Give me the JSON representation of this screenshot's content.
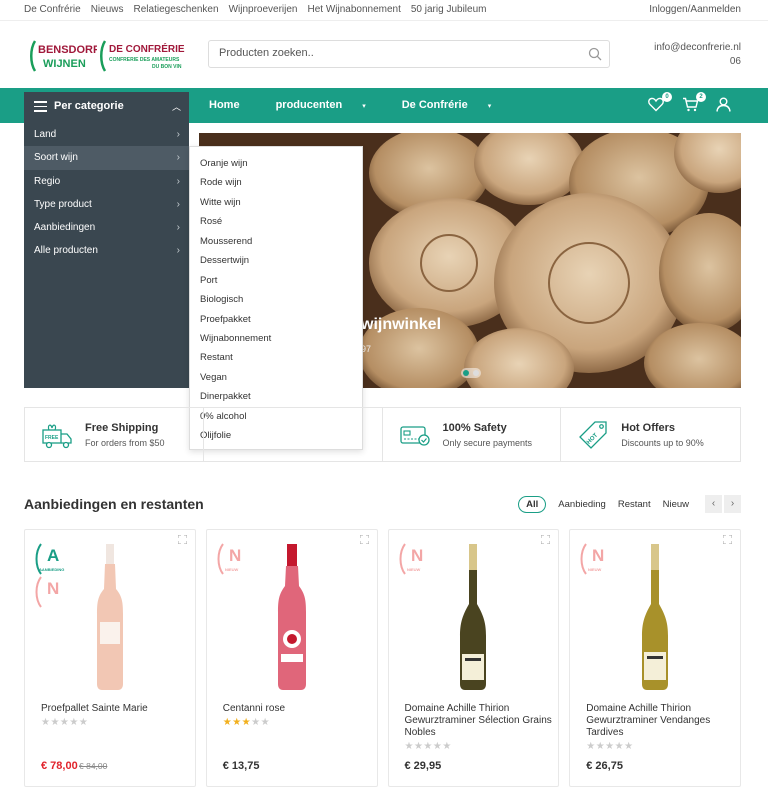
{
  "topbar": {
    "links": [
      "De Confrérie",
      "Nieuws",
      "Relatiegeschenken",
      "Wijnproeverijen",
      "Het Wijnabonnement",
      "50 jarig Jubileum"
    ],
    "login": "Inloggen/Aanmelden"
  },
  "header": {
    "logo1_line1": "BENSDORP",
    "logo1_line2": "WIJNEN",
    "logo2_line1": "DE CONFRÉRIE",
    "logo2_line2": "CONFRERIE DES AMATEURS",
    "logo2_line3": "DU BON VIN",
    "search_placeholder": "Producten zoeken..",
    "email": "info@deconfrerie.nl",
    "phone": "06"
  },
  "nav": {
    "category_title": "Per categorie",
    "links": [
      "Home",
      "producenten",
      "De Confrérie"
    ],
    "wishlist_count": "0",
    "cart_count": "2"
  },
  "categories": [
    "Land",
    "Soort wijn",
    "Regio",
    "Type product",
    "Aanbiedingen",
    "Alle producten"
  ],
  "dropdown": [
    "Oranje wijn",
    "Rode wijn",
    "Witte wijn",
    "Rosé",
    "Mousserend",
    "Dessertwijn",
    "Port",
    "Biologisch",
    "Proefpakket",
    "Wijnabonnement",
    "Restant",
    "Vegan",
    "Dinerpakket",
    "0% alcohol",
    "Olijfolie"
  ],
  "hero": {
    "text": "wijnwinkel",
    "sub": "97"
  },
  "features": [
    {
      "title": "Free Shipping",
      "sub": "For orders from $50",
      "icon": "truck-icon"
    },
    {
      "title": "",
      "sub": "",
      "icon": ""
    },
    {
      "title": "100% Safety",
      "sub": "Only secure payments",
      "icon": "card-icon"
    },
    {
      "title": "Hot Offers",
      "sub": "Discounts up to 90%",
      "icon": "tag-icon"
    }
  ],
  "section": {
    "title": "Aanbiedingen en restanten",
    "filters": [
      "All",
      "Aanbieding",
      "Restant",
      "Nieuw"
    ]
  },
  "products": [
    {
      "name": "Proefpallet Sainte Marie",
      "rating": 0,
      "price": "€ 78,00",
      "old_price": "€ 84,00",
      "label_a": "A",
      "label_a_text": "AANBIEDING",
      "label_n": "N",
      "label_n_text": "NIEUW"
    },
    {
      "name": "Centanni rose",
      "rating": 3,
      "price": "€ 13,75",
      "label_n": "N",
      "label_n_text": "NIEUW"
    },
    {
      "name": "Domaine Achille Thirion Gewurztraminer Sélection Grains Nobles",
      "rating": 0,
      "price": "€ 29,95",
      "label_n": "N",
      "label_n_text": "NIEUW"
    },
    {
      "name": "Domaine Achille Thirion Gewurztraminer Vendanges Tardives",
      "rating": 0,
      "price": "€ 26,75",
      "label_n": "N",
      "label_n_text": "NIEUW"
    }
  ],
  "colors": {
    "accent": "#1a9e86",
    "sidebar": "#3a4750",
    "sale": "#e1242c",
    "brand_green": "#1a9e5a",
    "brand_red": "#a0183a"
  }
}
